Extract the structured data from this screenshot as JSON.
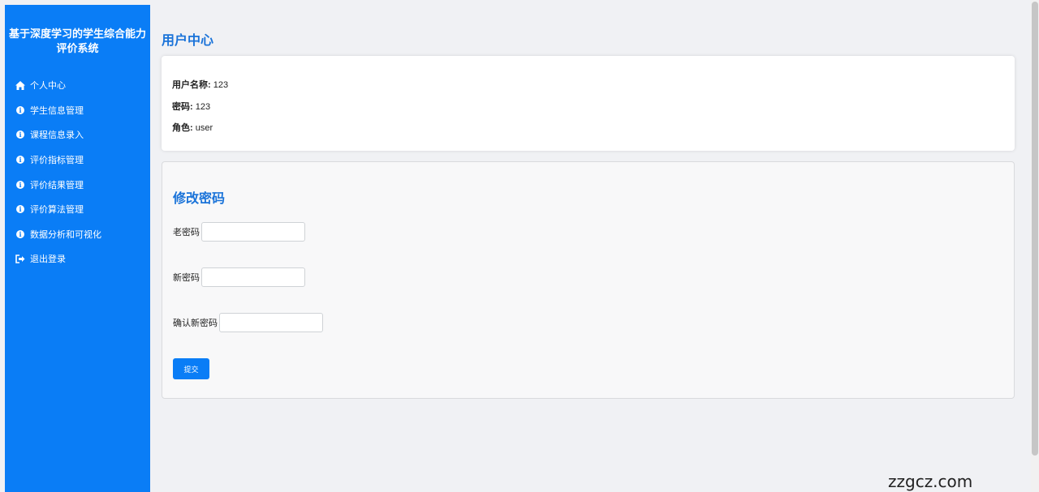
{
  "sidebar": {
    "title_line1": "基于深度学习的学生综合能力",
    "title_line2": "评价系统",
    "items": [
      {
        "label": "个人中心",
        "icon": "home-icon"
      },
      {
        "label": "学生信息管理",
        "icon": "info-icon"
      },
      {
        "label": "课程信息录入",
        "icon": "info-icon"
      },
      {
        "label": "评价指标管理",
        "icon": "info-icon"
      },
      {
        "label": "评价结果管理",
        "icon": "info-icon"
      },
      {
        "label": "评价算法管理",
        "icon": "info-icon"
      },
      {
        "label": "数据分析和可视化",
        "icon": "info-icon"
      },
      {
        "label": "退出登录",
        "icon": "logout-icon"
      }
    ]
  },
  "main": {
    "title": "用户中心",
    "user_info": {
      "username_label": "用户名称:",
      "username_value": "123",
      "password_label": "密码:",
      "password_value": "123",
      "role_label": "角色:",
      "role_value": "user"
    },
    "change_password": {
      "title": "修改密码",
      "old_label": "老密码",
      "new_label": "新密码",
      "confirm_label": "确认新密码",
      "old_value": "",
      "new_value": "",
      "confirm_value": "",
      "submit_label": "提交"
    }
  },
  "watermark": "zzgcz.com",
  "colors": {
    "sidebar_bg": "#0a7df6",
    "accent_title": "#1a73d9",
    "page_bg": "#f0f1f4"
  }
}
